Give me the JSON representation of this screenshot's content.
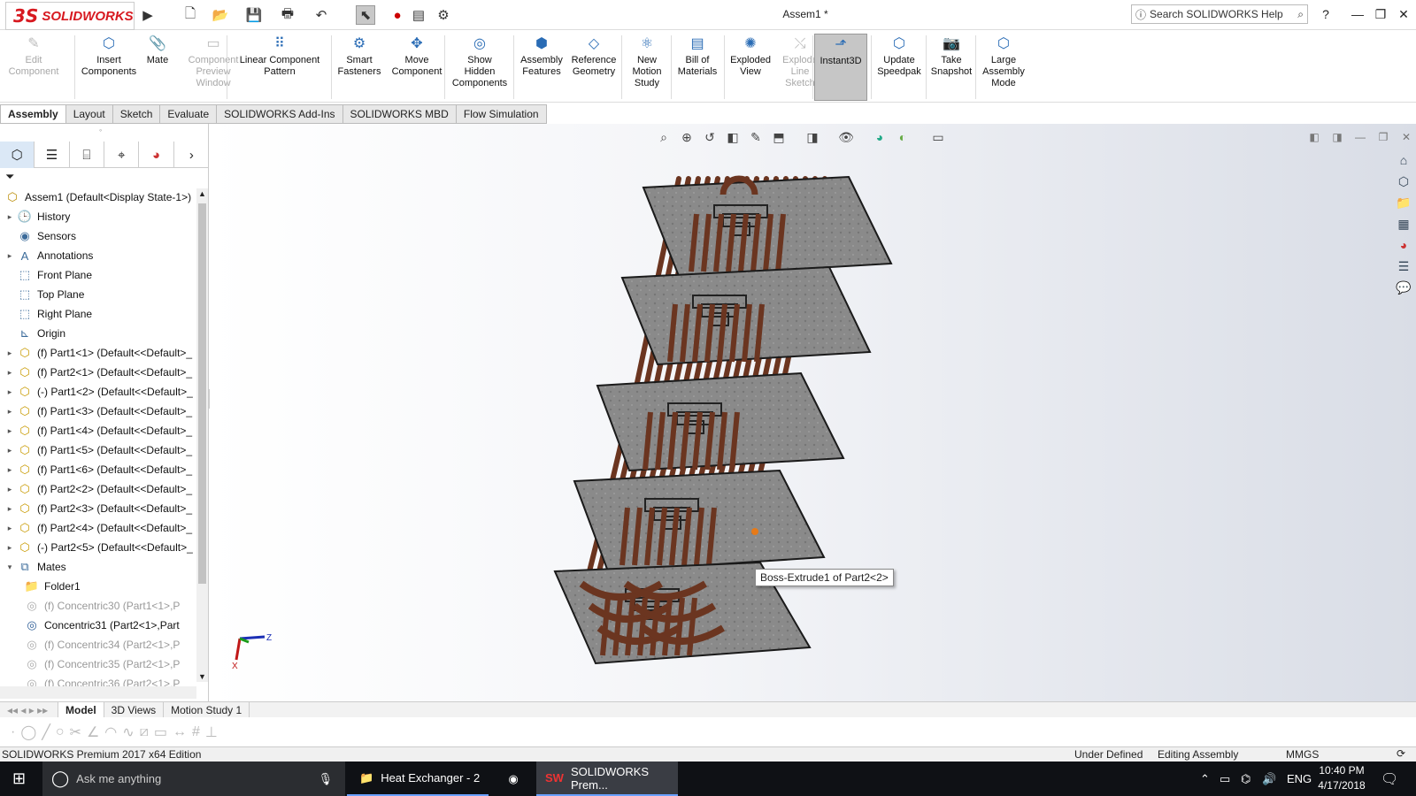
{
  "app": {
    "logo_mark": "3S",
    "logo_text": "SOLIDWORKS",
    "doc_title": "Assem1 *",
    "search_placeholder": "Search SOLIDWORKS Help",
    "help_label": "?"
  },
  "quick_access": [
    "new-icon",
    "open-icon",
    "save-icon",
    "print-icon",
    "undo-icon",
    "select-icon",
    "rebuild-icon",
    "file-properties-icon",
    "options-icon"
  ],
  "commands": [
    {
      "label": "Edit\nComponent",
      "icon": "edit-component-icon",
      "disabled": true
    },
    {
      "label": "Insert\nComponents",
      "icon": "insert-components-icon",
      "disabled": false
    },
    {
      "label": "Mate",
      "icon": "mate-icon",
      "disabled": false
    },
    {
      "label": "Component\nPreview\nWindow",
      "icon": "component-preview-icon",
      "disabled": true
    },
    {
      "label": "Linear Component\nPattern",
      "icon": "linear-pattern-icon",
      "disabled": false
    },
    {
      "label": "Smart\nFasteners",
      "icon": "smart-fasteners-icon",
      "disabled": false
    },
    {
      "label": "Move\nComponent",
      "icon": "move-component-icon",
      "disabled": false
    },
    {
      "label": "Show\nHidden\nComponents",
      "icon": "show-hidden-icon",
      "disabled": false
    },
    {
      "label": "Assembly\nFeatures",
      "icon": "assembly-features-icon",
      "disabled": false
    },
    {
      "label": "Reference\nGeometry",
      "icon": "reference-geometry-icon",
      "disabled": false
    },
    {
      "label": "New\nMotion\nStudy",
      "icon": "motion-study-icon",
      "disabled": false
    },
    {
      "label": "Bill of\nMaterials",
      "icon": "bom-icon",
      "disabled": false
    },
    {
      "label": "Exploded\nView",
      "icon": "exploded-view-icon",
      "disabled": false
    },
    {
      "label": "Explode\nLine\nSketch",
      "icon": "explode-line-icon",
      "disabled": true
    },
    {
      "label": "Instant3D",
      "icon": "instant3d-icon",
      "disabled": false,
      "active": true
    },
    {
      "label": "Update\nSpeedpak",
      "icon": "speedpak-icon",
      "disabled": false
    },
    {
      "label": "Take\nSnapshot",
      "icon": "snapshot-icon",
      "disabled": false
    },
    {
      "label": "Large\nAssembly\nMode",
      "icon": "large-assembly-icon",
      "disabled": false
    }
  ],
  "tabs": [
    "Assembly",
    "Layout",
    "Sketch",
    "Evaluate",
    "SOLIDWORKS Add-Ins",
    "SOLIDWORKS MBD",
    "Flow Simulation"
  ],
  "tree": {
    "root": "Assem1  (Default<Display State-1>)",
    "items": [
      {
        "label": "History",
        "icon": "history-icon",
        "expand": "▸"
      },
      {
        "label": "Sensors",
        "icon": "sensors-icon",
        "expand": ""
      },
      {
        "label": "Annotations",
        "icon": "annotations-icon",
        "expand": "▸"
      },
      {
        "label": "Front Plane",
        "icon": "plane-icon",
        "expand": ""
      },
      {
        "label": "Top Plane",
        "icon": "plane-icon",
        "expand": ""
      },
      {
        "label": "Right Plane",
        "icon": "plane-icon",
        "expand": ""
      },
      {
        "label": "Origin",
        "icon": "origin-icon",
        "expand": ""
      },
      {
        "label": "(f) Part1<1> (Default<<Default>_",
        "icon": "part-icon",
        "expand": "▸"
      },
      {
        "label": "(f) Part2<1> (Default<<Default>_",
        "icon": "part-icon",
        "expand": "▸"
      },
      {
        "label": "(-) Part1<2> (Default<<Default>_",
        "icon": "part-icon",
        "expand": "▸"
      },
      {
        "label": "(f) Part1<3> (Default<<Default>_",
        "icon": "part-icon",
        "expand": "▸"
      },
      {
        "label": "(f) Part1<4> (Default<<Default>_",
        "icon": "part-icon",
        "expand": "▸"
      },
      {
        "label": "(f) Part1<5> (Default<<Default>_",
        "icon": "part-icon",
        "expand": "▸"
      },
      {
        "label": "(f) Part1<6> (Default<<Default>_",
        "icon": "part-icon",
        "expand": "▸"
      },
      {
        "label": "(f) Part2<2> (Default<<Default>_",
        "icon": "part-icon",
        "expand": "▸"
      },
      {
        "label": "(f) Part2<3> (Default<<Default>_",
        "icon": "part-icon",
        "expand": "▸"
      },
      {
        "label": "(f) Part2<4> (Default<<Default>_",
        "icon": "part-icon",
        "expand": "▸"
      },
      {
        "label": "(-) Part2<5> (Default<<Default>_",
        "icon": "part-icon",
        "expand": "▸"
      },
      {
        "label": "Mates",
        "icon": "mates-icon",
        "expand": "▾"
      }
    ],
    "mates": [
      {
        "label": "Folder1",
        "icon": "folder-icon",
        "gray": false
      },
      {
        "label": "(f) Concentric30 (Part1<1>,P",
        "icon": "concentric-icon",
        "gray": true
      },
      {
        "label": "Concentric31 (Part2<1>,Part",
        "icon": "concentric-icon",
        "gray": false
      },
      {
        "label": "(f) Concentric34 (Part2<1>,P",
        "icon": "concentric-icon",
        "gray": true
      },
      {
        "label": "(f) Concentric35 (Part2<1>,P",
        "icon": "concentric-icon",
        "gray": true
      },
      {
        "label": "(f) Concentric36 (Part2<1>,P",
        "icon": "concentric-icon",
        "gray": true
      }
    ]
  },
  "viewport": {
    "tooltip": "Boss-Extrude1 of Part2<2>",
    "triad_z": "Z",
    "triad_x": "X"
  },
  "bottom_tabs": [
    "Model",
    "3D Views",
    "Motion Study 1"
  ],
  "status": {
    "edition": "SOLIDWORKS Premium 2017 x64 Edition",
    "state": "Under Defined",
    "mode": "Editing Assembly",
    "units": "MMGS"
  },
  "taskbar": {
    "search": "Ask me anything",
    "app1": "Heat Exchanger - 2",
    "app2": "SOLIDWORKS Prem...",
    "lang": "ENG",
    "time": "10:40 PM",
    "date": "4/17/2018"
  }
}
